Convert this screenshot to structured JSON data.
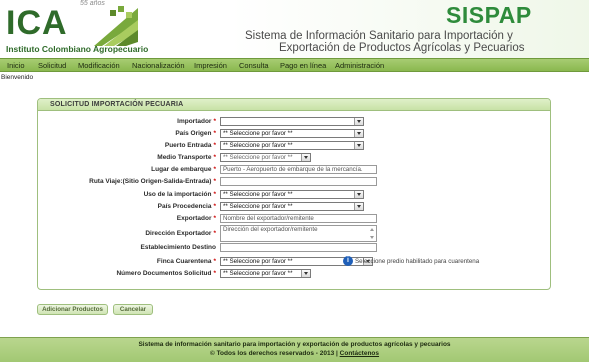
{
  "header": {
    "logo_text": "ICA",
    "logo_badge": "55 años",
    "logo_subtitle": "Instituto Colombiano Agropecuario",
    "app_name": "SISPAP",
    "app_desc_line1": "Sistema de Información Sanitario para Importación y",
    "app_desc_line2": "Exportación de Productos Agrícolas y Pecuarios"
  },
  "menu": {
    "items": [
      "Inicio",
      "Solicitud",
      "Modificación",
      "Nacionalización",
      "Impresión",
      "Consulta",
      "Pago en línea",
      "Administración"
    ]
  },
  "welcome": "Bienvenido",
  "form": {
    "title": "SOLICITUD IMPORTACIÓN PECUARIA",
    "required_mark": "*",
    "fields": {
      "importador": {
        "label": "Importador",
        "value": ""
      },
      "pais_origen": {
        "label": "País Origen",
        "value": "** Seleccione por favor **"
      },
      "puerto_entrada": {
        "label": "Puerto Entrada",
        "value": "** Seleccione por favor **"
      },
      "medio_transporte": {
        "label": "Medio Transporte",
        "value": "** Seleccione por favor **"
      },
      "lugar_embarque": {
        "label": "Lugar de embarque",
        "placeholder": "Puerto - Aeropuerto de embarque de la mercancía."
      },
      "ruta_viaje": {
        "label": "Ruta Viaje:(Sitio Origen-Salida-Entrada)",
        "value": ""
      },
      "uso_importacion": {
        "label": "Uso de la importación",
        "value": "** Seleccione por favor **"
      },
      "pais_procedencia": {
        "label": "País Procedencia",
        "value": "** Seleccione por favor **"
      },
      "exportador": {
        "label": "Exportador",
        "placeholder": "Nombre del exportador/remitente"
      },
      "direccion_exportador": {
        "label": "Dirección Exportador",
        "placeholder": "Dirección del exportador/remitente"
      },
      "establecimiento_destino": {
        "label": "Establecimiento Destino",
        "value": ""
      },
      "finca_cuarentena": {
        "label": "Finca Cuarentena",
        "value": "** Seleccione por favor **",
        "info": "Seleccione predio habilitado para cuarentena"
      },
      "numero_documentos": {
        "label": "Número Documentos Solicitud",
        "value": "** Seleccione por favor **"
      }
    }
  },
  "buttons": {
    "add_products": "Adicionar Productos",
    "cancel": "Cancelar"
  },
  "footer": {
    "line1": "Sistema de información sanitario para importación y exportación de productos agrícolas y pecuarios",
    "line2": "© Todos los derechos reservados - 2013 |",
    "contact": "Contáctenos"
  },
  "colors": {
    "brand_green": "#2f6b2a",
    "menu_green": "#8ab84f",
    "required_red": "#cc0000",
    "info_blue": "#1f5fb8"
  }
}
